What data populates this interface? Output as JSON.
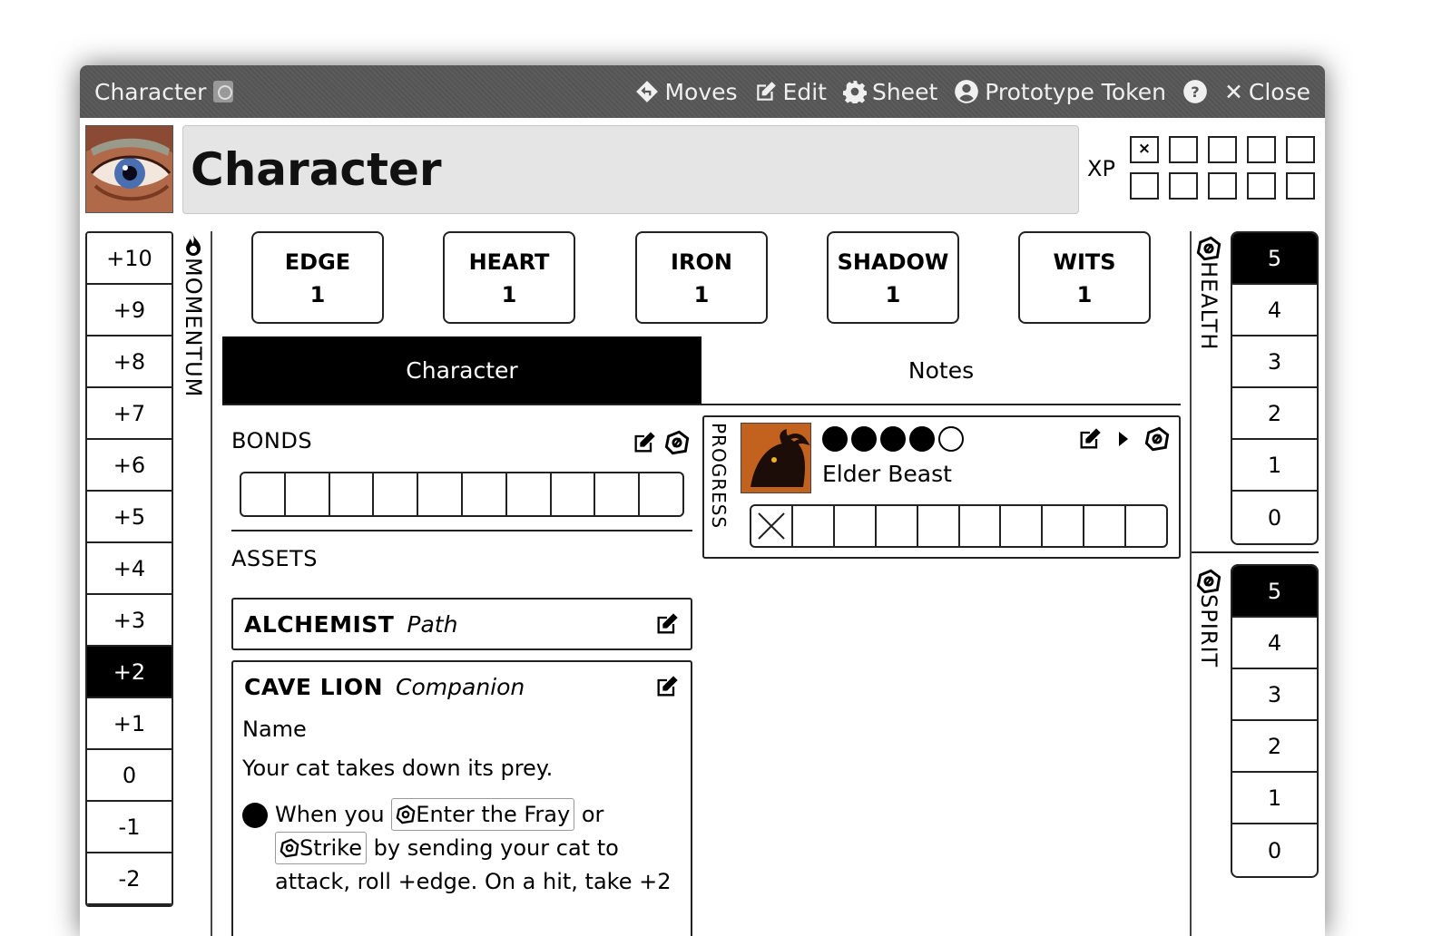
{
  "window": {
    "title": "Character",
    "actions": {
      "moves": "Moves",
      "edit": "Edit",
      "sheet": "Sheet",
      "prototype_token": "Prototype Token",
      "close": "Close"
    }
  },
  "header": {
    "name": "Character",
    "xp_label": "XP",
    "xp_marked": "×"
  },
  "momentum": {
    "label": "MOMENTUM",
    "values": [
      "+10",
      "+9",
      "+8",
      "+7",
      "+6",
      "+5",
      "+4",
      "+3",
      "+2",
      "+1",
      "0",
      "-1",
      "-2"
    ],
    "current": "+2"
  },
  "stats": {
    "edge": {
      "label": "EDGE",
      "value": "1"
    },
    "heart": {
      "label": "HEART",
      "value": "1"
    },
    "iron": {
      "label": "IRON",
      "value": "1"
    },
    "shadow": {
      "label": "SHADOW",
      "value": "1"
    },
    "wits": {
      "label": "WITS",
      "value": "1"
    }
  },
  "tabs": {
    "character": "Character",
    "notes": "Notes"
  },
  "bonds": {
    "title": "BONDS"
  },
  "assets": {
    "title": "ASSETS",
    "alchemist": {
      "name": "ALCHEMIST",
      "type": "Path"
    },
    "cave_lion": {
      "name": "CAVE LION",
      "type": "Companion",
      "field_label": "Name",
      "description": "Your cat takes down its prey.",
      "ability_1": "When you",
      "move_1": "Enter the Fray",
      "or": "or",
      "move_2": "Strike",
      "ability_1_rest": "by sending your cat to",
      "ability_1_cont": "attack, roll +edge. On a hit, take +2"
    }
  },
  "progress": {
    "label": "PROGRESS",
    "name": "Elder Beast",
    "rank_filled": 4,
    "rank_total": 5
  },
  "health": {
    "label": "HEALTH",
    "values": [
      "5",
      "4",
      "3",
      "2",
      "1",
      "0"
    ],
    "current": "5"
  },
  "spirit": {
    "label": "SPIRIT",
    "values": [
      "5",
      "4",
      "3",
      "2",
      "1",
      "0"
    ],
    "current": "5"
  }
}
